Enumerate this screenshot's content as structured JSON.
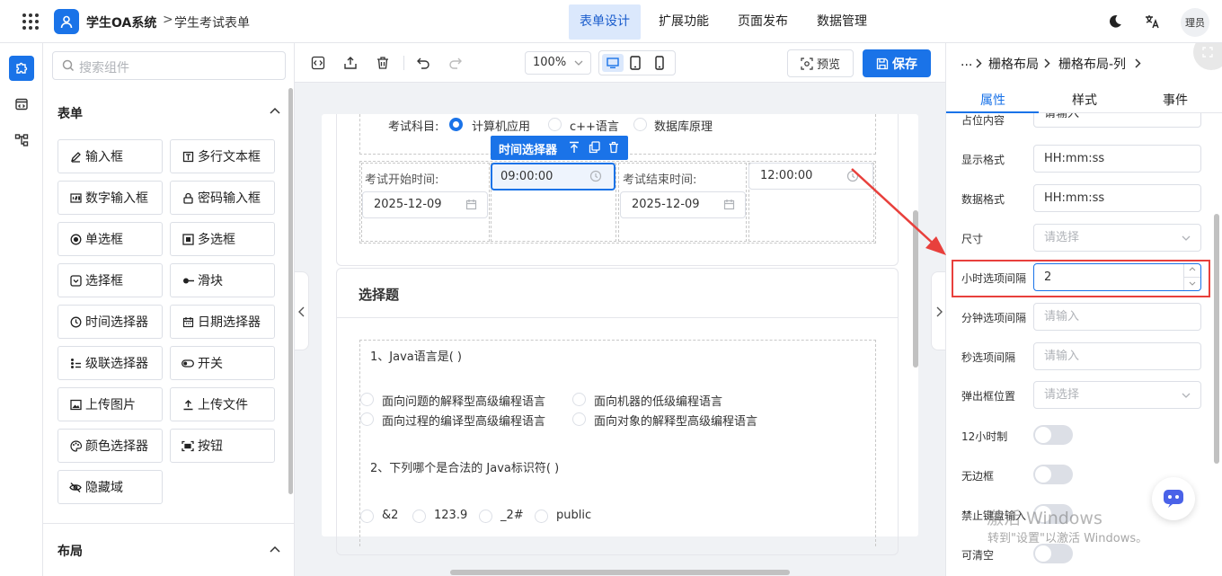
{
  "colors": {
    "primary": "#1a73e8",
    "annotation_red": "#e8403c",
    "border": "#dcdfe6"
  },
  "header": {
    "app_title": "学生OA系统",
    "breadcrumb_sep": ">",
    "breadcrumb": "学生考试表单",
    "nav_tabs": [
      "表单设计",
      "扩展功能",
      "页面发布",
      "数据管理"
    ],
    "active_tab": "表单设计",
    "avatar_text": "理员"
  },
  "component_panel": {
    "search_placeholder": "搜索组件",
    "form_section": "表单",
    "components": [
      {
        "label": "输入框",
        "icon": "edit-icon"
      },
      {
        "label": "多行文本框",
        "icon": "textarea-icon"
      },
      {
        "label": "数字输入框",
        "icon": "number-icon"
      },
      {
        "label": "密码输入框",
        "icon": "lock-icon"
      },
      {
        "label": "单选框",
        "icon": "radio-icon"
      },
      {
        "label": "多选框",
        "icon": "checkbox-icon"
      },
      {
        "label": "选择框",
        "icon": "select-icon"
      },
      {
        "label": "滑块",
        "icon": "slider-icon"
      },
      {
        "label": "时间选择器",
        "icon": "clock-icon"
      },
      {
        "label": "日期选择器",
        "icon": "calendar-icon"
      },
      {
        "label": "级联选择器",
        "icon": "cascader-icon"
      },
      {
        "label": "开关",
        "icon": "switch-icon"
      },
      {
        "label": "上传图片",
        "icon": "image-icon"
      },
      {
        "label": "上传文件",
        "icon": "upload-icon"
      },
      {
        "label": "颜色选择器",
        "icon": "palette-icon"
      },
      {
        "label": "按钮",
        "icon": "button-icon"
      },
      {
        "label": "隐藏域",
        "icon": "eye-off-icon"
      }
    ],
    "layout_section": "布局"
  },
  "toolbar": {
    "zoom": "100%",
    "preview_label": "预览",
    "save_label": "保存"
  },
  "canvas": {
    "subject_label": "考试科目:",
    "subjects": [
      "计算机应用",
      "c++语言",
      "数据库原理"
    ],
    "selected_subject": "计算机应用",
    "tag_label": "时间选择器",
    "start_label": "考试开始时间:",
    "start_date": "2025-12-09",
    "start_time": "09:00:00",
    "end_label": "考试结束时间:",
    "end_date": "2025-12-09",
    "end_time": "12:00:00",
    "choice_section": "选择题",
    "q1": "1、Java语言是( )",
    "q1_options": [
      "面向问题的解释型高级编程语言",
      "面向机器的低级编程语言",
      "面向过程的编译型高级编程语言",
      "面向对象的解释型高级编程语言"
    ],
    "q2": "2、下列哪个是合法的 Java标识符( )",
    "q2_options": [
      "&2",
      "123.9",
      "_2#",
      "public"
    ]
  },
  "props_panel": {
    "breadcrumb_ellipsis": "...",
    "breadcrumb": [
      "栅格布局",
      "栅格布局-列"
    ],
    "tabs": [
      "属性",
      "样式",
      "事件"
    ],
    "active_tab": "属性",
    "rows": {
      "placeholder_label": "占位内容",
      "placeholder_value": "请输入",
      "display_label": "显示格式",
      "display_value": "HH:mm:ss",
      "data_label": "数据格式",
      "data_value": "HH:mm:ss",
      "size_label": "尺寸",
      "size_placeholder": "请选择",
      "hour_label": "小时选项间隔",
      "hour_value": "2",
      "minute_label": "分钟选项间隔",
      "minute_placeholder": "请输入",
      "second_label": "秒选项间隔",
      "second_placeholder": "请输入",
      "popup_label": "弹出框位置",
      "popup_placeholder": "请选择",
      "h12_label": "12小时制",
      "borderless_label": "无边框",
      "nokeyboard_label": "禁止键盘输入",
      "clearable_label": "可清空"
    }
  },
  "watermark": {
    "line1": "激活 Windows",
    "line2": "转到\"设置\"以激活 Windows。"
  }
}
